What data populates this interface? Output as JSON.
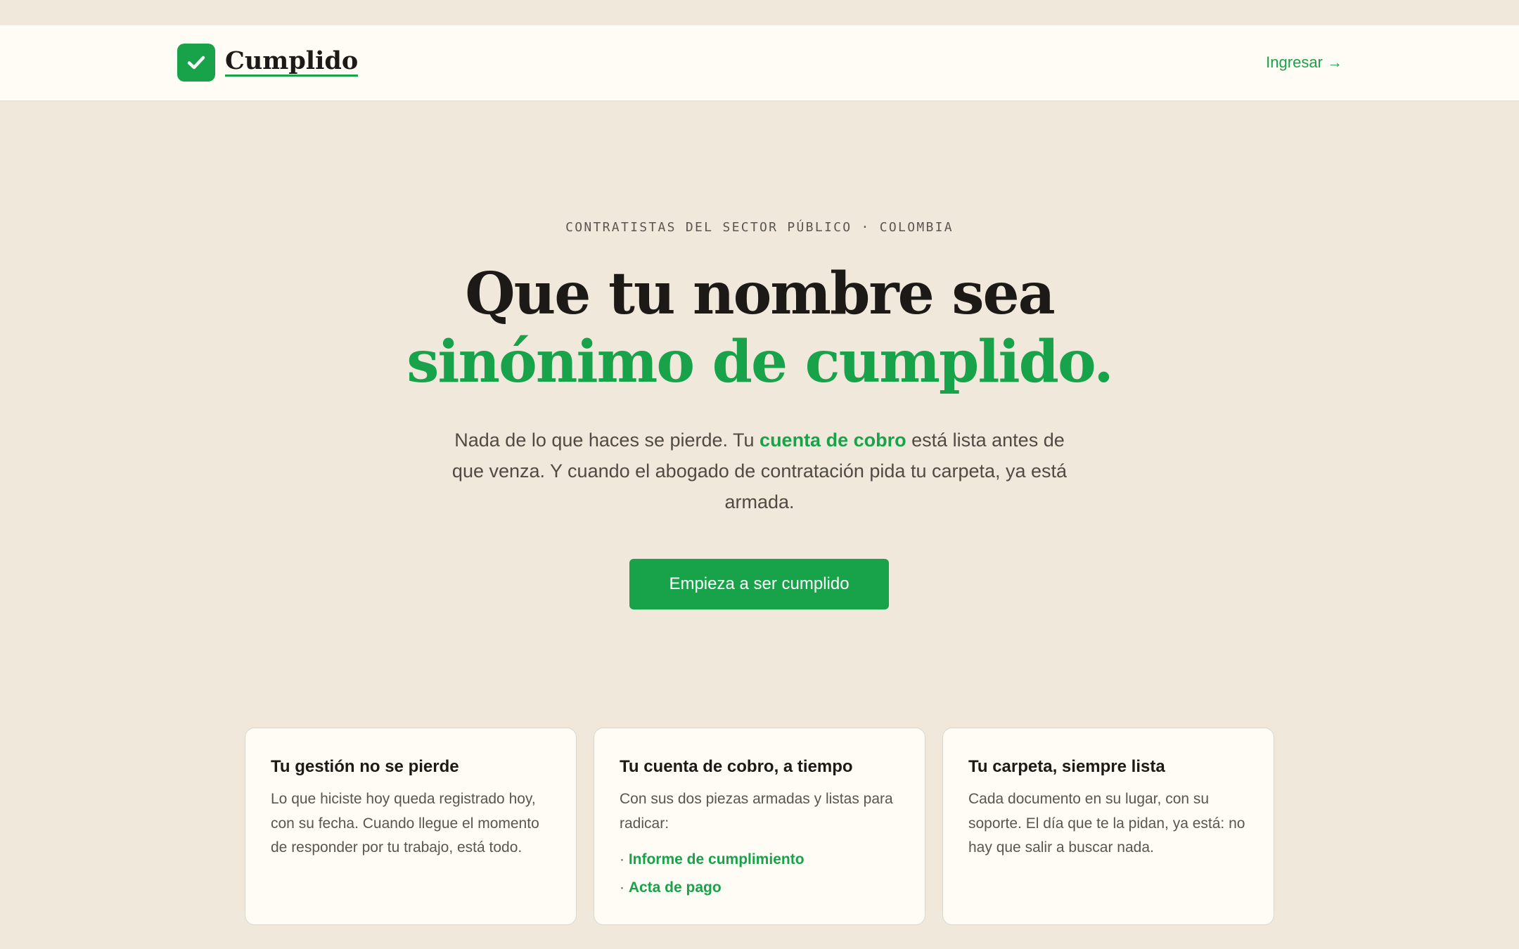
{
  "header": {
    "brand": "Cumplido",
    "login_label": "Ingresar →"
  },
  "hero": {
    "eyebrow": "CONTRATISTAS DEL SECTOR PÚBLICO · COLOMBIA",
    "headline_line1": "Que tu nombre sea",
    "headline_line2": "sinónimo de cumplido.",
    "lead_part1": "Nada de lo que haces se pierde. Tu ",
    "lead_highlight": "cuenta de cobro",
    "lead_part2": " está lista antes de que venza. Y cuando el abogado de contratación pida tu carpeta, ya está armada.",
    "cta_label": "Empieza a ser cumplido"
  },
  "features": [
    {
      "title": "Tu gestión no se pierde",
      "body": "Lo que hiciste hoy queda registrado hoy, con su fecha. Cuando llegue el momento de responder por tu trabajo, está todo."
    },
    {
      "title": "Tu cuenta de cobro, a tiempo",
      "body": "Con sus dos piezas armadas y listas para radicar:",
      "items": [
        "Informe de cumplimiento",
        "Acta de pago"
      ]
    },
    {
      "title": "Tu carpeta, siempre lista",
      "body": "Cada documento en su lugar, con su soporte. El día que te la pidan, ya está: no hay que salir a buscar nada."
    }
  ],
  "colors": {
    "accent": "#18a34a",
    "background": "#f0e9db",
    "surface": "#fefcf5",
    "text": "#1c1916"
  },
  "icons": {
    "logo": "checkmark-icon"
  }
}
